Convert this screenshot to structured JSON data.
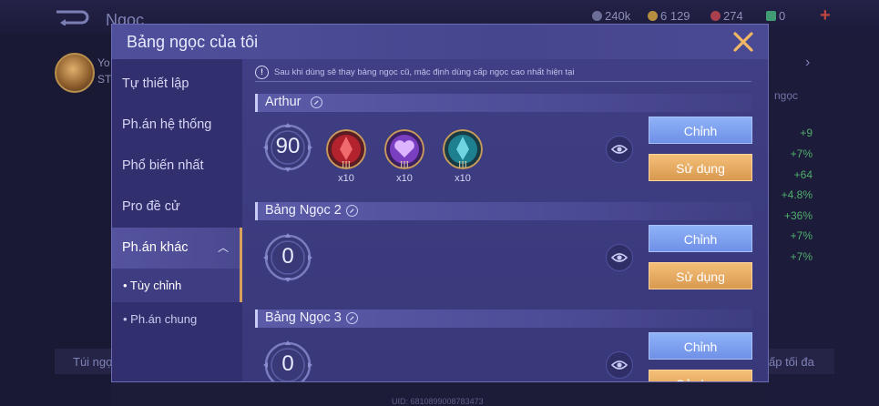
{
  "background": {
    "title": "Ngọc",
    "resources": [
      "240k",
      "6 129",
      "274",
      "0"
    ],
    "profile_lines": [
      "Yo",
      "ST"
    ],
    "right_label": "ngọc",
    "stats": [
      "+9",
      "+7%",
      "+64",
      "+4.8%",
      "+36%",
      "+7%",
      "+7%"
    ],
    "bottom_left": "Túi ngọ",
    "bottom_right": "ấp tối đa",
    "uid": "UID: 6810899008783473"
  },
  "dialog": {
    "title": "Bảng ngọc của tôi",
    "notice": "Sau khi dùng sẽ thay bảng ngọc cũ, mặc định dùng cấp ngọc cao nhất hiện tại"
  },
  "nav": {
    "items": [
      "Tự thiết lập",
      "Ph.án hệ thống",
      "Phổ biến nhất",
      "Pro đề cử",
      "Ph.án khác"
    ],
    "sub_items": [
      "• Tùy chỉnh",
      "• Ph.án chung"
    ]
  },
  "pages": [
    {
      "name": "Arthur",
      "level": "90",
      "runes": [
        {
          "color": "red",
          "tier": "III",
          "count": "x10"
        },
        {
          "color": "purple",
          "tier": "III",
          "count": "x10"
        },
        {
          "color": "teal",
          "tier": "III",
          "count": "x10"
        }
      ]
    },
    {
      "name": "Bảng Ngọc 2",
      "level": "0",
      "runes": []
    },
    {
      "name": "Bảng Ngọc 3",
      "level": "0",
      "runes": []
    }
  ],
  "buttons": {
    "edit": "Chỉnh",
    "use": "Sử dụng"
  },
  "colors": {
    "accent": "#d9a25c",
    "edit_button": "#7f9ff0",
    "use_button": "#e6a960",
    "panel": "#3c3c80"
  }
}
